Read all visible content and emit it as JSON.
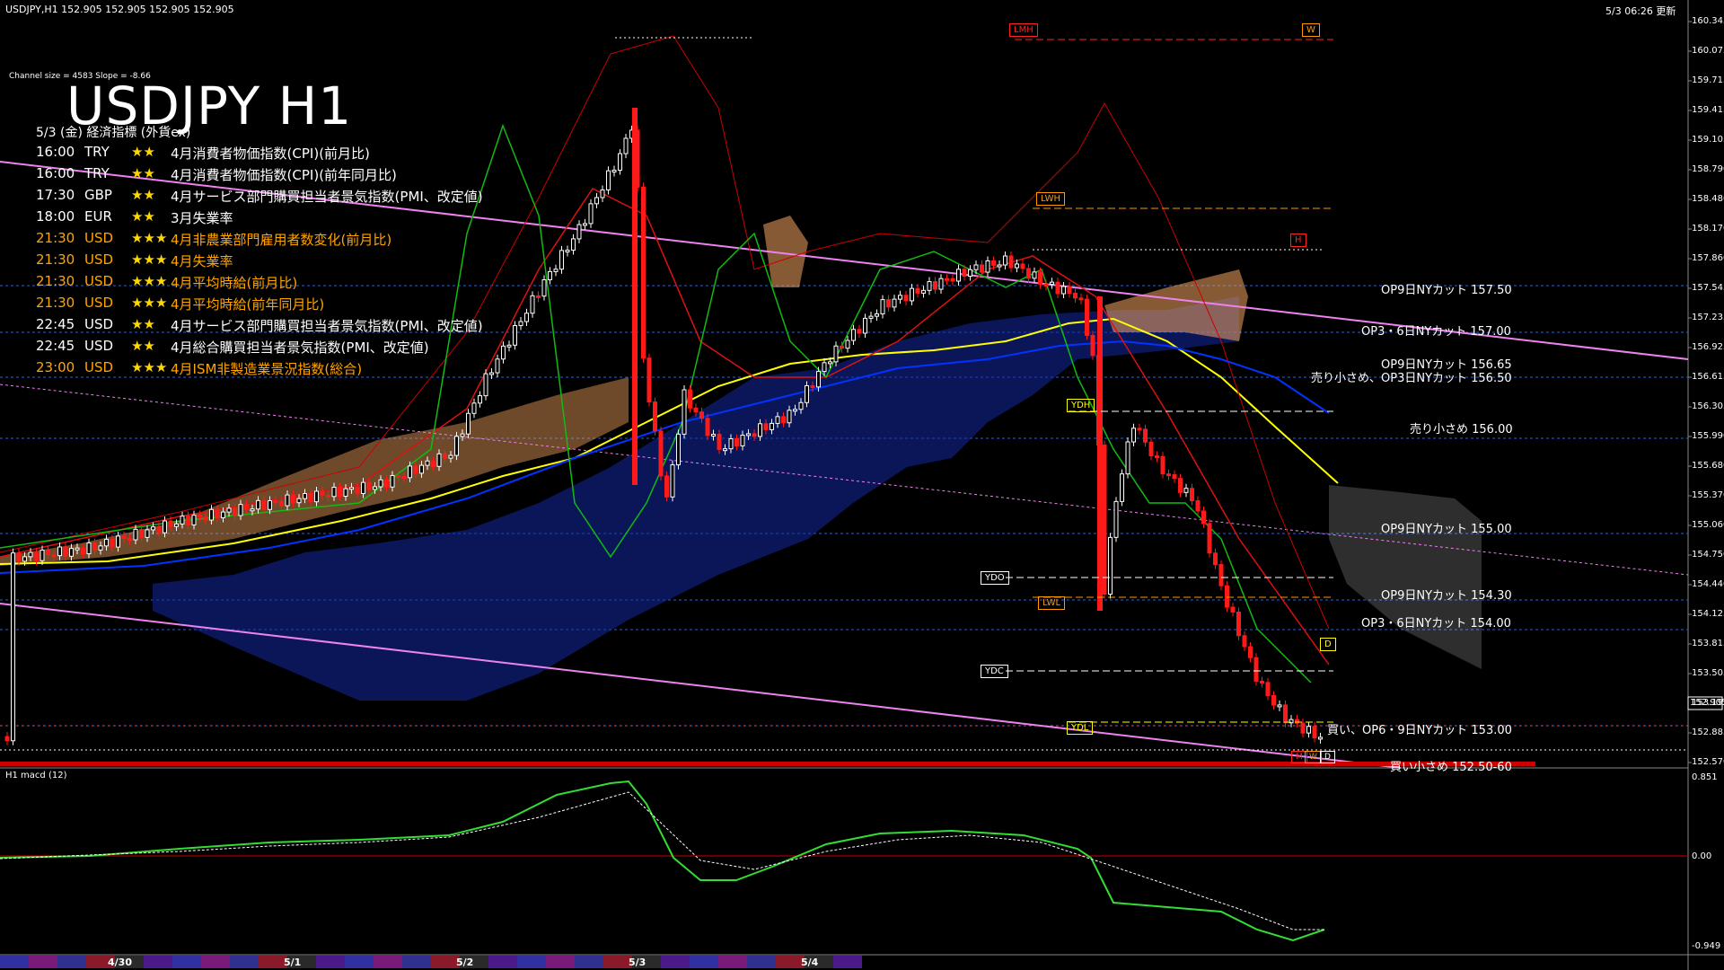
{
  "header": {
    "symbol_info": "USDJPY,H1  152.905 152.905 152.905 152.905",
    "datetime_right": "5/3 06:26 更新",
    "channel_info": "Channel size = 4583 Slope = -8.66"
  },
  "title": "USDJPY H1",
  "calendar": {
    "heading": "5/3 (金) 経済指標 (外貨ex)",
    "events": [
      {
        "time": "16:00",
        "ccy": "TRY",
        "stars": "★★",
        "name": "4月消費者物価指数(CPI)(前月比)"
      },
      {
        "time": "16:00",
        "ccy": "TRY",
        "stars": "★★",
        "name": "4月消費者物価指数(CPI)(前年同月比)"
      },
      {
        "time": "17:30",
        "ccy": "GBP",
        "stars": "★★",
        "name": "4月サービス部門購買担当者景気指数(PMI、改定値)"
      },
      {
        "time": "18:00",
        "ccy": "EUR",
        "stars": "★★",
        "name": "3月失業率"
      },
      {
        "time": "21:30",
        "ccy": "USD",
        "stars": "★★★",
        "name": "4月非農業部門雇用者数変化(前月比)"
      },
      {
        "time": "21:30",
        "ccy": "USD",
        "stars": "★★★",
        "name": "4月失業率"
      },
      {
        "time": "21:30",
        "ccy": "USD",
        "stars": "★★★",
        "name": "4月平均時給(前月比)"
      },
      {
        "time": "21:30",
        "ccy": "USD",
        "stars": "★★★",
        "name": "4月平均時給(前年同月比)"
      },
      {
        "time": "22:45",
        "ccy": "USD",
        "stars": "★★",
        "name": "4月サービス部門購買担当者景気指数(PMI、改定値)"
      },
      {
        "time": "22:45",
        "ccy": "USD",
        "stars": "★★",
        "name": "4月総合購買担当者景気指数(PMI、改定値)"
      },
      {
        "time": "23:00",
        "ccy": "USD",
        "stars": "★★★",
        "name": "4月ISM非製造業景況指数(総合)"
      }
    ]
  },
  "price_axis": [
    "160.345",
    "160.075",
    "159.715",
    "159.415",
    "159.105",
    "158.790",
    "158.480",
    "158.170",
    "157.860",
    "157.545",
    "157.235",
    "156.925",
    "156.615",
    "156.305",
    "155.990",
    "155.680",
    "155.370",
    "155.060",
    "154.750",
    "154.440",
    "154.125",
    "153.815",
    "153.505",
    "153.195",
    "152.885",
    "152.570"
  ],
  "current_price": "152.905",
  "level_boxes": {
    "lmh": "LMH",
    "w_top": "W",
    "lwh": "LWH",
    "h_box": "H",
    "ydh": "YDH",
    "ydo": "YDO",
    "lwl": "LWL",
    "ydc": "YDC",
    "ydl": "YDL",
    "d1": "D",
    "m": "M",
    "w2": "W",
    "d2": "D"
  },
  "cut_labels": [
    "OP9日NYカット 157.50",
    "OP3・6日NYカット 157.00",
    "OP9日NYカット 156.65",
    "売り小さめ、OP3日NYカット 156.50",
    "売り小さめ 156.00",
    "OP9日NYカット 155.00",
    "OP9日NYカット 154.30",
    "OP3・6日NYカット 154.00",
    "買い、OP6・9日NYカット 153.00",
    "買い小さめ 152.50-60"
  ],
  "macd": {
    "label": "H1  macd (12)",
    "axis": [
      "0.851",
      "0.00",
      "-0.949"
    ]
  },
  "dates": [
    "4/30",
    "5/1",
    "5/2",
    "5/3",
    "5/4"
  ],
  "colors": {
    "bg": "#000000",
    "bull": "#ffffff",
    "bear": "#ff0000",
    "ma_yellow": "#ffff00",
    "ma_blue": "#0000ff",
    "ma_green": "#00cc00",
    "channel": "#ee82ee",
    "cloud": "#f4a460",
    "dash_blue": "#3060d0",
    "orange": "#ff9900"
  }
}
